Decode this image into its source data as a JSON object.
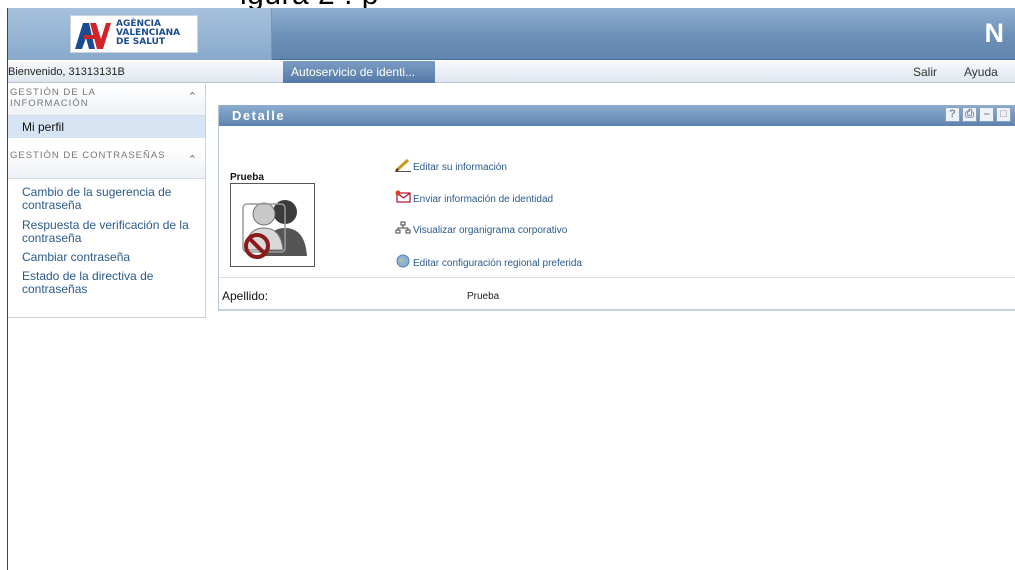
{
  "cropped_heading": "igura 2 . p",
  "header": {
    "logo": {
      "line1": "AGÈNCIA",
      "line2": "VALENCIANA",
      "line3": "DE SALUT"
    },
    "brand_letter": "N"
  },
  "navbar": {
    "welcome": "Bienvenido, 31313131B",
    "app_tab": "Autoservicio de identi...",
    "links": {
      "logout": "Salir",
      "help": "Ayuda"
    }
  },
  "sidebar": {
    "sections": [
      {
        "title": "GESTIÓN DE LA INFORMACIÓN",
        "items": [
          "Mi perfil"
        ]
      },
      {
        "title": "GESTIÓN DE CONTRASEÑAS",
        "items": [
          "Cambio de la sugerencia de contraseña",
          "Respuesta de verificación de la contraseña",
          "Cambiar contraseña",
          "Estado de la directiva de contraseñas"
        ]
      }
    ]
  },
  "panel": {
    "title": "Detalle",
    "buttons": {
      "help": "?",
      "print": "⎙",
      "minimize": "–",
      "maximize": "□"
    },
    "photo_label": "Prueba",
    "actions": [
      {
        "label": "Editar su información",
        "icon": "pencil-icon"
      },
      {
        "label": "Enviar información de identidad",
        "icon": "envelope-icon"
      },
      {
        "label": "Visualizar organigrama corporativo",
        "icon": "org-chart-icon"
      },
      {
        "label": "Editar configuración regional preferida",
        "icon": "globe-icon"
      }
    ],
    "field": {
      "label": "Apellido:",
      "value": "Prueba"
    }
  },
  "colors": {
    "header": "#6d90b8",
    "active_item": "#d6e4f3",
    "link": "#2a5a8c"
  }
}
